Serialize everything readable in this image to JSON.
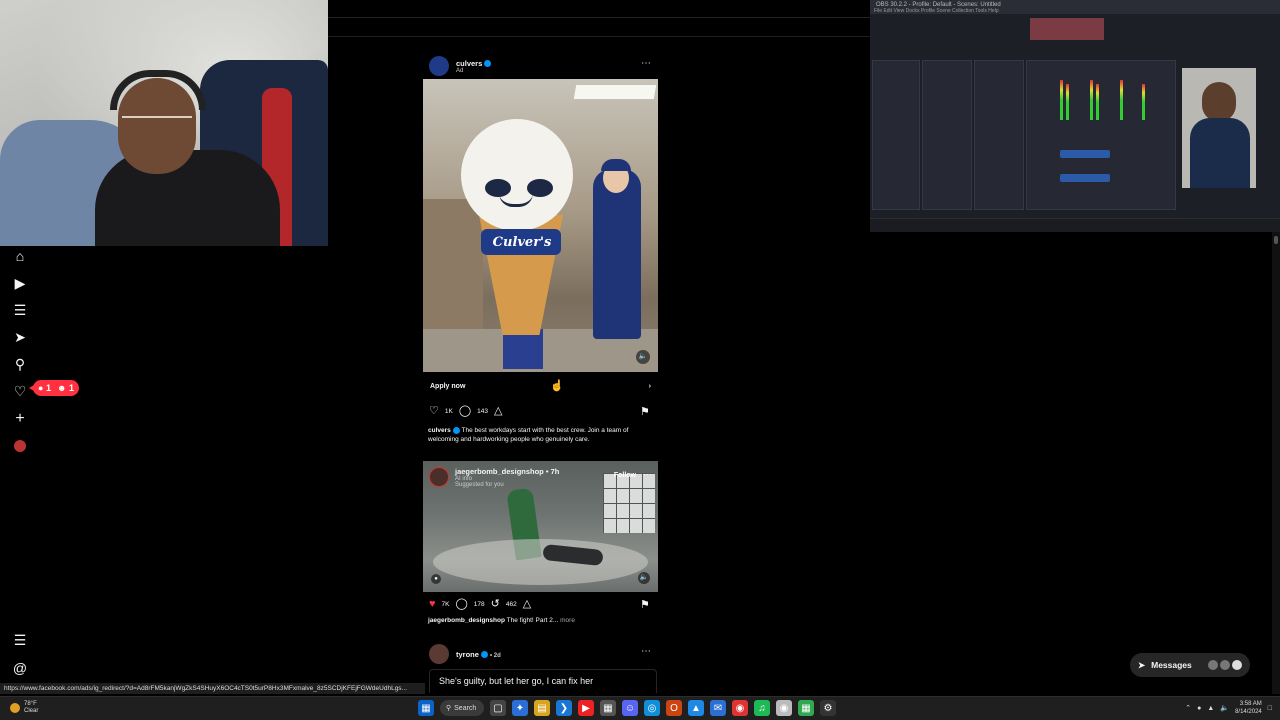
{
  "feed": {
    "post1": {
      "username": "culvers",
      "sublabel": "Ad",
      "apply_label": "Apply now",
      "likes": "1K",
      "comments": "143",
      "caption_user": "culvers",
      "caption_text": "The best workdays start with the best crew. Join a team of welcoming and hardworking people who genuinely care.",
      "mascot_text": "Culver's"
    },
    "post2": {
      "username": "jaegerbomb_designshop",
      "time": "• 7h",
      "ai_label": "AI info",
      "suggested": "Suggested for you",
      "follow_label": "Follow",
      "likes": "7K",
      "comments": "178",
      "reposts": "462",
      "caption_user": "jaegerbomb_designshop",
      "caption_text": "The fight! Part 2...",
      "more_label": "more"
    },
    "post3": {
      "username": "tyrone",
      "time": "• 2d",
      "text": "She's guilty, but let her go, I can fix her"
    }
  },
  "notifications": {
    "comments": "1",
    "follows": "1"
  },
  "messages": {
    "label": "Messages"
  },
  "status_url": "https://www.facebook.com/ads/ig_redirect/?d=Ad8rFM5kanjWgZkS4SHuyX6OC4cTS0t5urP8Hx3MFxmalve_8z5SCDjKFEjFGWdeUdhLgs...",
  "taskbar": {
    "weather_temp": "78°F",
    "weather_desc": "Clear",
    "search_label": "Search",
    "time": "3:58 AM",
    "date": "8/14/2024"
  },
  "obs": {
    "title": "OBS 30.2.2 - Profile: Default - Scenes: Untitled",
    "menu": "File  Edit  View  Docks  Profile  Scene Collection  Tools  Help"
  },
  "colors": {
    "background": "#000000",
    "accent_red": "#ff3040",
    "verified_blue": "#0095f6"
  }
}
